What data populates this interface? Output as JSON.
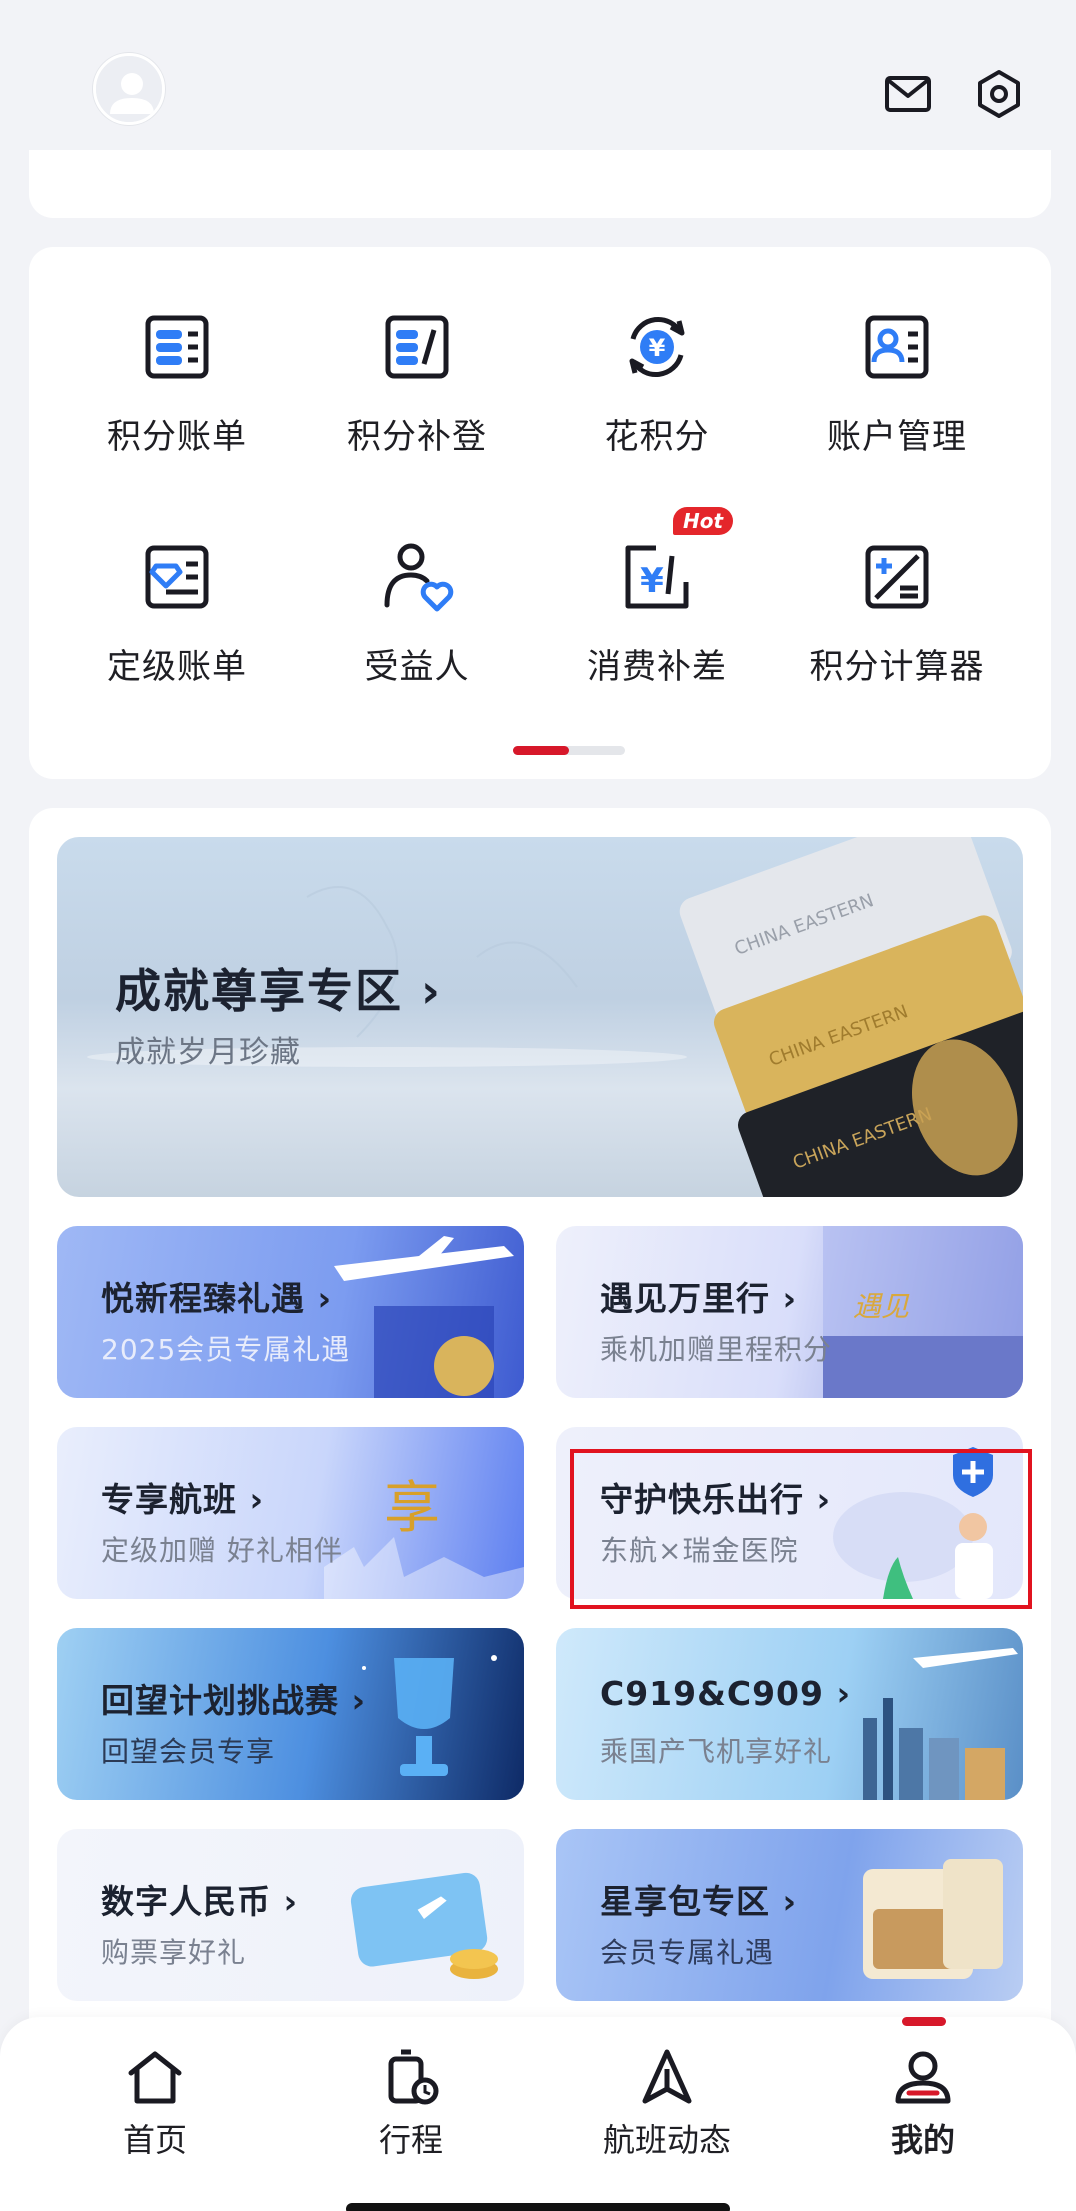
{
  "header": {
    "avatar_icon": "user-avatar-icon",
    "mail_icon": "mail-icon",
    "settings_icon": "settings-hex-icon"
  },
  "services": {
    "items": [
      {
        "label": "积分账单",
        "icon": "points-bill-icon"
      },
      {
        "label": "积分补登",
        "icon": "points-supplement-icon"
      },
      {
        "label": "花积分",
        "icon": "spend-points-icon"
      },
      {
        "label": "账户管理",
        "icon": "account-manage-icon"
      },
      {
        "label": "定级账单",
        "icon": "tier-bill-icon"
      },
      {
        "label": "受益人",
        "icon": "beneficiary-icon"
      },
      {
        "label": "消费补差",
        "icon": "consume-supplement-icon",
        "badge": "Hot"
      },
      {
        "label": "积分计算器",
        "icon": "points-calculator-icon"
      }
    ],
    "page_indicator": {
      "pages": 2,
      "active": 1
    }
  },
  "banner": {
    "title": "成就尊享专区 ›",
    "subtitle": "成就岁月珍藏"
  },
  "promos": [
    {
      "title": "悦新程臻礼遇 ›",
      "subtitle": "2025会员专属礼遇"
    },
    {
      "title": "遇见万里行 ›",
      "subtitle": "乘机加赠里程积分"
    },
    {
      "title": "专享航班 ›",
      "subtitle": "定级加赠 好礼相伴"
    },
    {
      "title": "守护快乐出行 ›",
      "subtitle": "东航×瑞金医院"
    },
    {
      "title": "回望计划挑战赛 ›",
      "subtitle": "回望会员专享"
    },
    {
      "title": "C919&C909 ›",
      "subtitle": "乘国产飞机享好礼"
    },
    {
      "title": "数字人民币 ›",
      "subtitle": "购票享好礼"
    },
    {
      "title": "星享包专区 ›",
      "subtitle": "会员专属礼遇"
    }
  ],
  "nav": {
    "items": [
      {
        "label": "首页",
        "icon": "home-icon"
      },
      {
        "label": "行程",
        "icon": "trip-luggage-icon"
      },
      {
        "label": "航班动态",
        "icon": "flight-status-icon"
      },
      {
        "label": "我的",
        "icon": "profile-icon"
      }
    ],
    "active": "我的"
  },
  "colors": {
    "accent": "#d7182a",
    "primary_icon": "#1a1a22",
    "icon_blue": "#2f7df6",
    "background": "#f2f3f7"
  }
}
